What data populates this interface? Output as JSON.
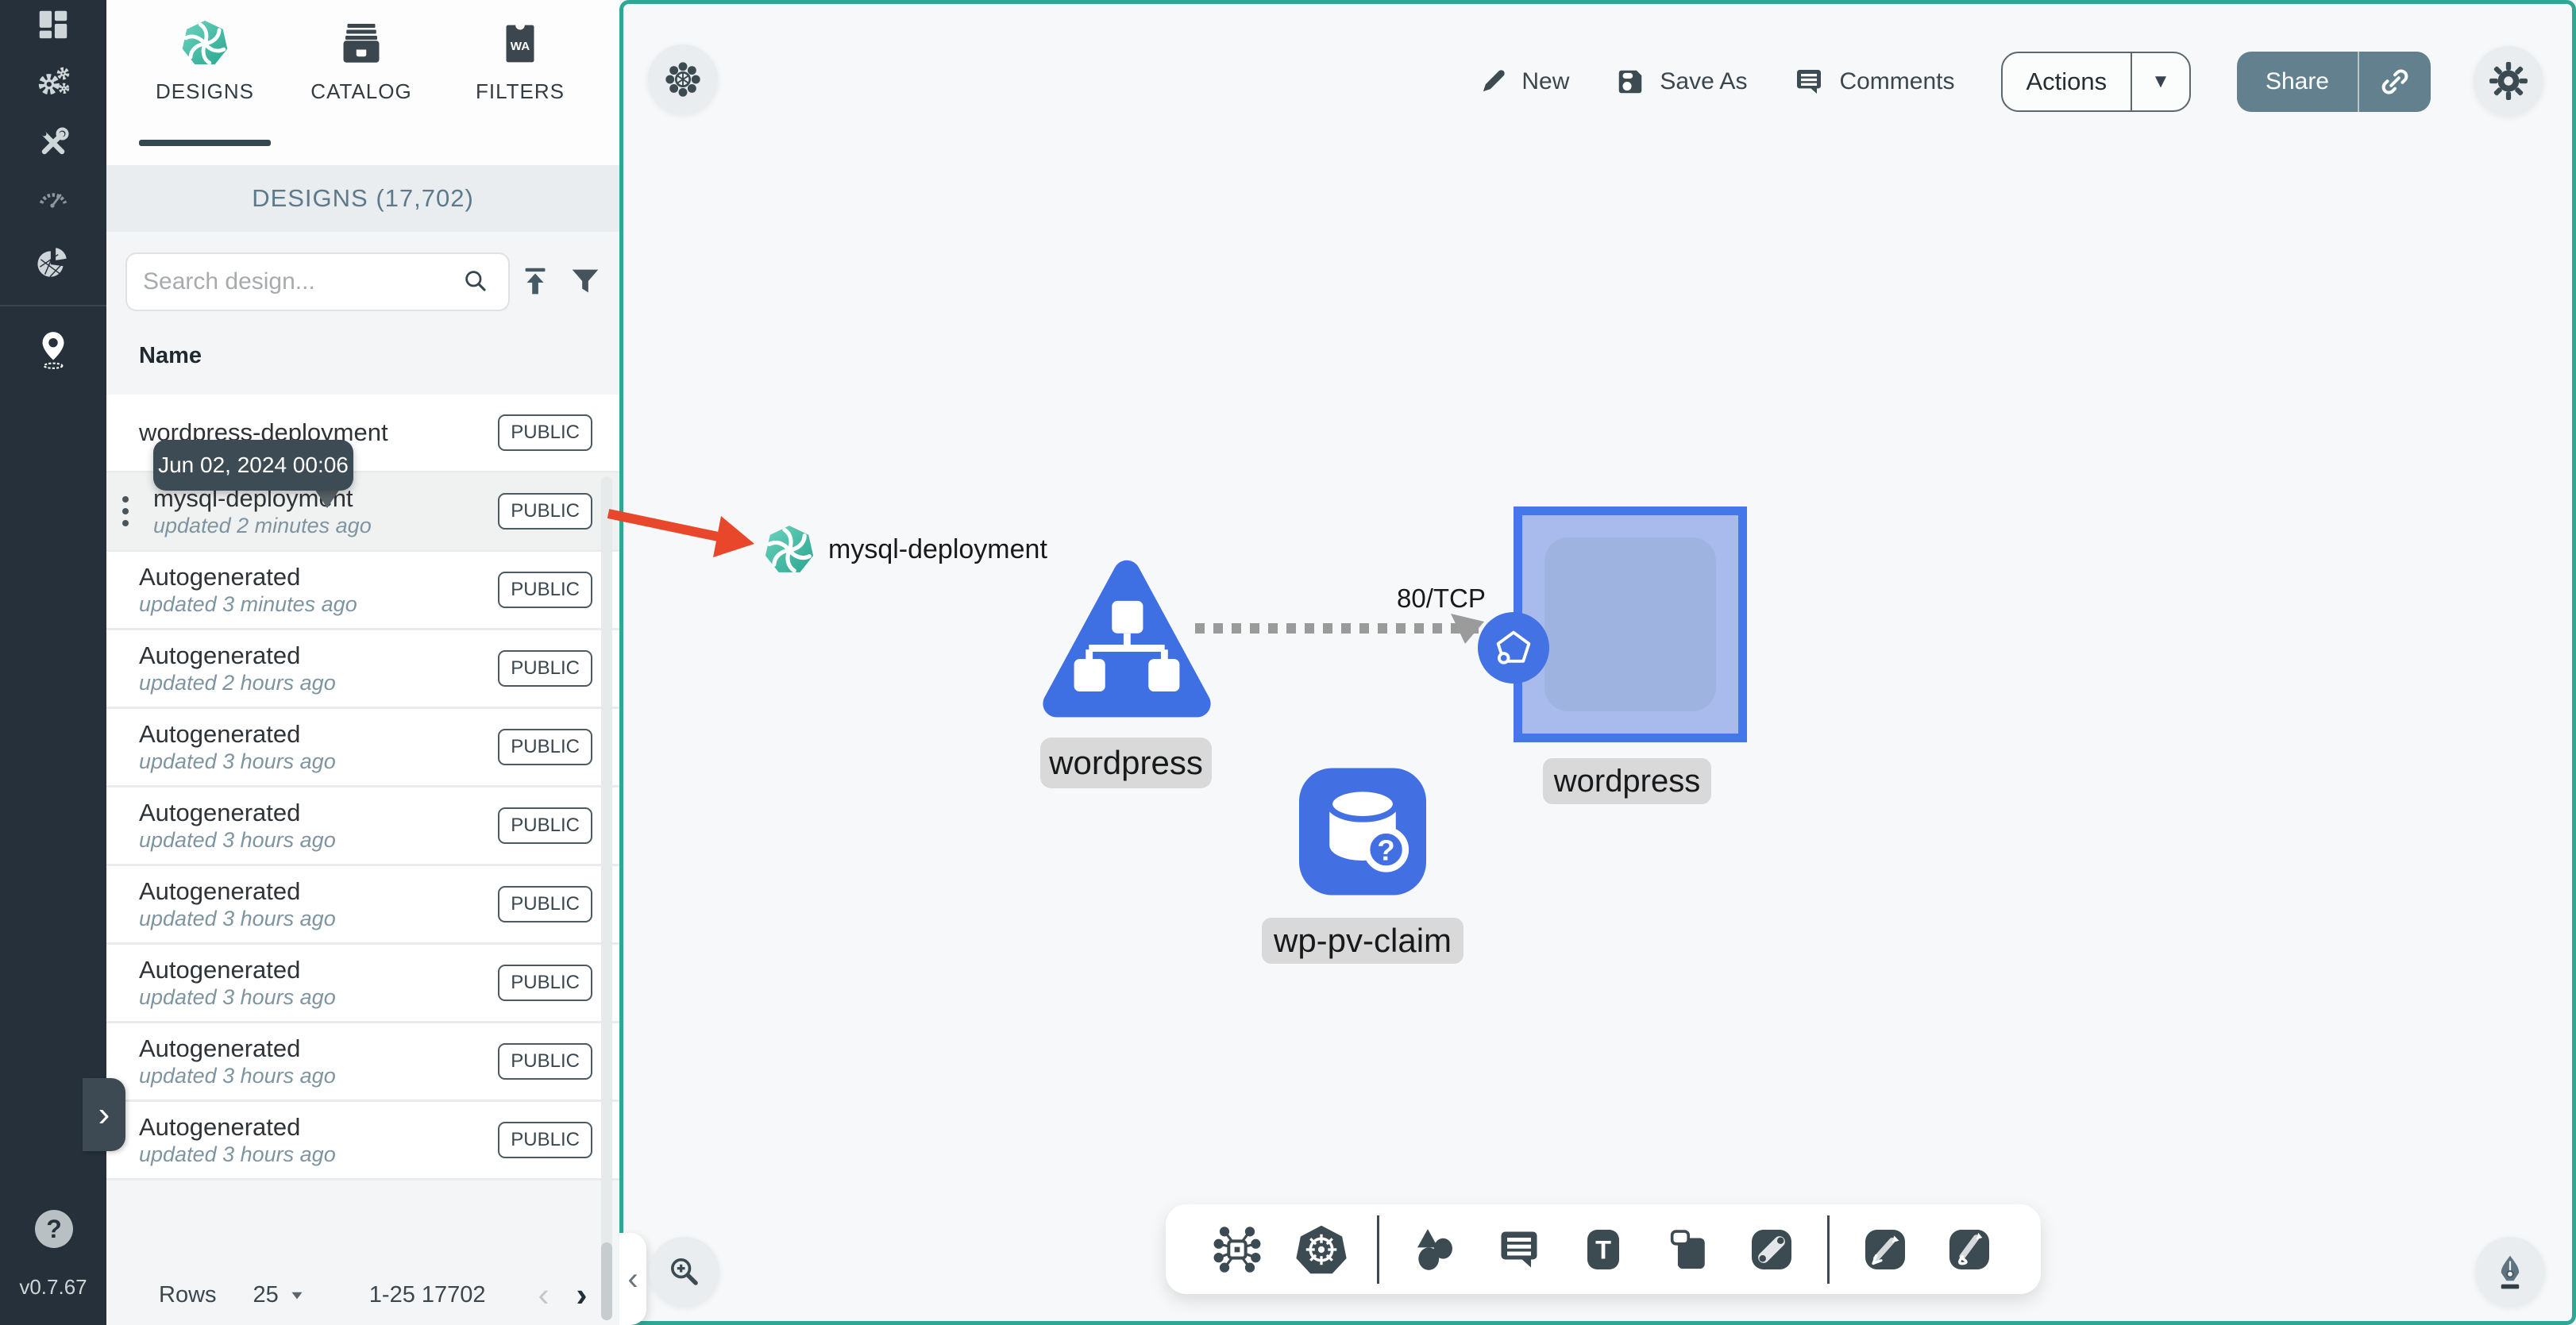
{
  "app": {
    "version": "v0.7.67"
  },
  "sidebar": {
    "icons": [
      "dashboard",
      "lifecycle-gears",
      "toolkit",
      "performance-gauge",
      "extensions-pie",
      "kanvas-pin"
    ],
    "help_label": "?",
    "expand_chevron": "›"
  },
  "panel": {
    "tabs": [
      {
        "label": "DESIGNS",
        "active": true
      },
      {
        "label": "CATALOG",
        "active": false
      },
      {
        "label": "FILTERS",
        "active": false
      }
    ],
    "header": "DESIGNS (17,702)",
    "search": {
      "placeholder": "Search design..."
    },
    "columns": {
      "name": "Name"
    },
    "tooltip": "Jun 02, 2024 00:06",
    "rows": [
      {
        "name": "wordpress-deployment",
        "updated": "",
        "badge": "PUBLIC"
      },
      {
        "name": "mysql-deployment",
        "updated": "updated 2 minutes ago",
        "badge": "PUBLIC"
      },
      {
        "name": "Autogenerated",
        "updated": "updated 3 minutes ago",
        "badge": "PUBLIC"
      },
      {
        "name": "Autogenerated",
        "updated": "updated 2 hours ago",
        "badge": "PUBLIC"
      },
      {
        "name": "Autogenerated",
        "updated": "updated 3 hours ago",
        "badge": "PUBLIC"
      },
      {
        "name": "Autogenerated",
        "updated": "updated 3 hours ago",
        "badge": "PUBLIC"
      },
      {
        "name": "Autogenerated",
        "updated": "updated 3 hours ago",
        "badge": "PUBLIC"
      },
      {
        "name": "Autogenerated",
        "updated": "updated 3 hours ago",
        "badge": "PUBLIC"
      },
      {
        "name": "Autogenerated",
        "updated": "updated 3 hours ago",
        "badge": "PUBLIC"
      },
      {
        "name": "Autogenerated",
        "updated": "updated 3 hours ago",
        "badge": "PUBLIC"
      }
    ],
    "pagination": {
      "rows_label": "Rows",
      "per_page": "25",
      "range": "1-25 17702",
      "prev": "‹",
      "next": "›"
    }
  },
  "toolbar": {
    "new": "New",
    "save_as": "Save As",
    "comments": "Comments",
    "actions": "Actions",
    "actions_caret": "▼",
    "share": "Share"
  },
  "canvas": {
    "nodes": {
      "mysql": {
        "label": "mysql-deployment"
      },
      "wordpress_deployment": {
        "label": "wordpress"
      },
      "wordpress_service": {
        "label": "wordpress",
        "port": "80/TCP"
      },
      "pvc": {
        "label": "wp-pv-claim"
      }
    },
    "bottom_toolbar_icons": [
      "component-graph",
      "kubernetes",
      "shapes",
      "notes",
      "text-tool",
      "layers",
      "connect-tool",
      "edge-pen",
      "freehand-pen"
    ]
  },
  "colors": {
    "accent_teal": "#2fa795",
    "brand_swirl": "#3fbaa6",
    "node_blue": "#3e6fe3",
    "arrow_red": "#e8472b",
    "share_button": "#63808f",
    "sidebar_bg": "#25303a",
    "tooltip_bg": "#3d4b54"
  }
}
